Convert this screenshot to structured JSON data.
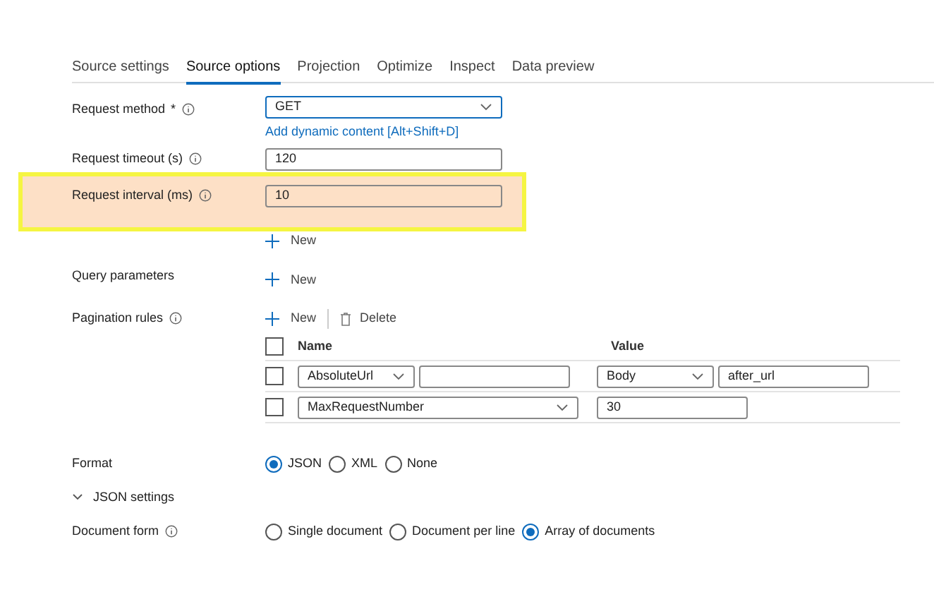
{
  "tabs": [
    {
      "label": "Source settings",
      "selected": false
    },
    {
      "label": "Source options",
      "selected": true
    },
    {
      "label": "Projection",
      "selected": false
    },
    {
      "label": "Optimize",
      "selected": false
    },
    {
      "label": "Inspect",
      "selected": false
    },
    {
      "label": "Data preview",
      "selected": false
    }
  ],
  "request_method": {
    "label": "Request method",
    "required_mark": "*",
    "value": "GET",
    "link": "Add dynamic content [Alt+Shift+D]"
  },
  "request_timeout": {
    "label": "Request timeout (s)",
    "value": "120"
  },
  "request_interval": {
    "label": "Request interval (ms)",
    "value": "10",
    "highlighted": true
  },
  "additional_headers": {
    "new_button": "New"
  },
  "query_parameters": {
    "label": "Query parameters",
    "new_button": "New"
  },
  "pagination_rules": {
    "label": "Pagination rules",
    "new_button": "New",
    "delete_button": "Delete",
    "columns": [
      "Name",
      "Value"
    ],
    "all_checked": false,
    "rows": [
      {
        "checked": false,
        "name_select": "AbsoluteUrl",
        "name_text": "",
        "value_select": "Body",
        "value_text": "after_url"
      },
      {
        "checked": false,
        "name_select": "MaxRequestNumber",
        "value_text": "30"
      }
    ]
  },
  "format": {
    "label": "Format",
    "options": [
      {
        "label": "JSON",
        "selected": true
      },
      {
        "label": "XML",
        "selected": false
      },
      {
        "label": "None",
        "selected": false
      }
    ]
  },
  "json_settings": {
    "label": "JSON settings",
    "expanded": true
  },
  "document_form": {
    "label": "Document form",
    "options": [
      {
        "label": "Single document",
        "selected": false
      },
      {
        "label": "Document per line",
        "selected": false
      },
      {
        "label": "Array of documents",
        "selected": true
      }
    ]
  }
}
